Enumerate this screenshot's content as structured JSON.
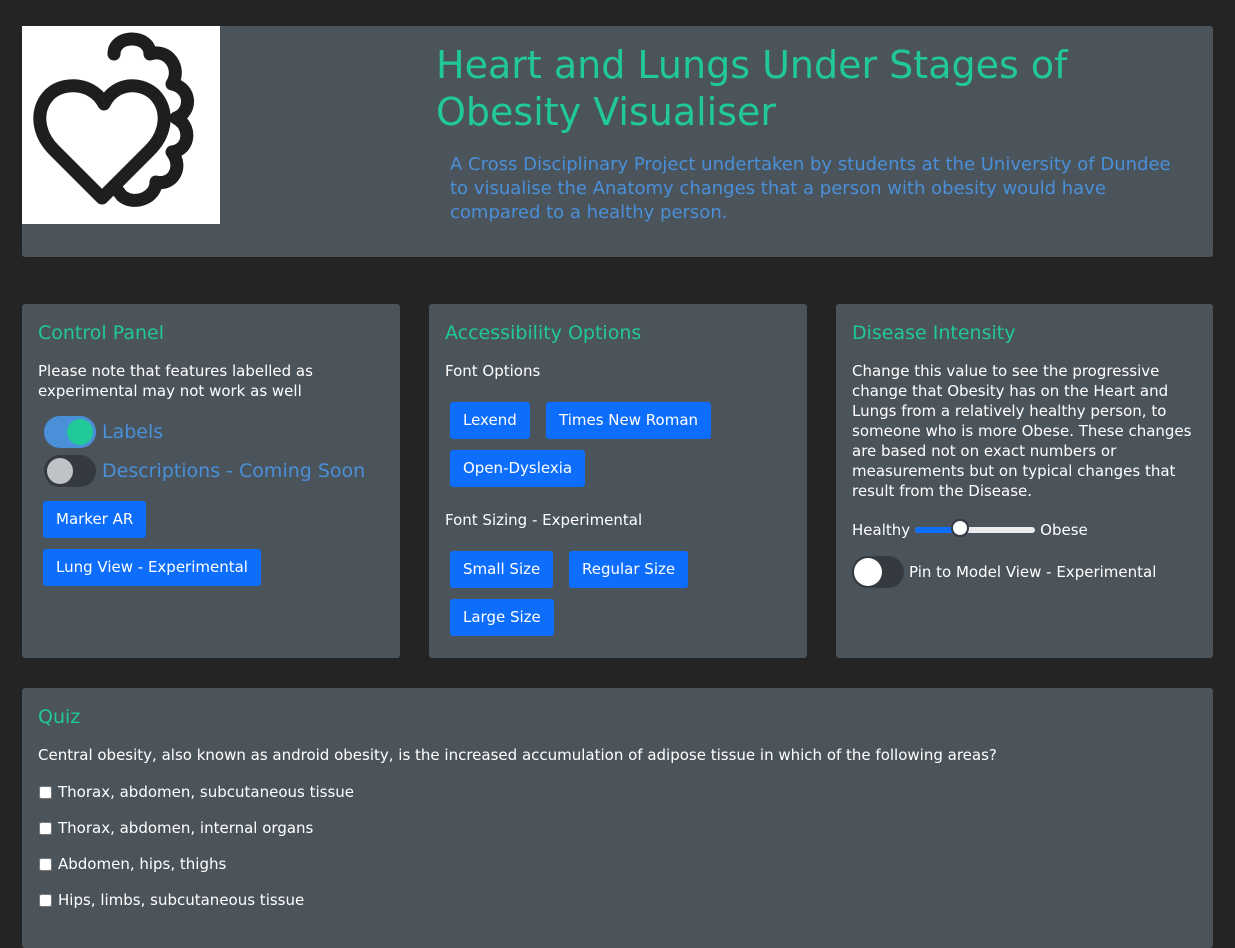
{
  "header": {
    "logo_name": "heart-and-lungs-logo",
    "title": "Heart and Lungs Under Stages of Obesity Visualiser",
    "subtitle": "A Cross Disciplinary Project undertaken by students at the University of Dundee to visualise the Anatomy changes that a person with obesity would have compared to a healthy person."
  },
  "control_panel": {
    "title": "Control Panel",
    "note": "Please note that features labelled as experimental may not work as well",
    "toggles": [
      {
        "label": "Labels",
        "on": true
      },
      {
        "label": "Descriptions - Coming Soon",
        "on": false
      }
    ],
    "buttons": {
      "marker_ar": "Marker AR",
      "lung_view": "Lung View - Experimental"
    }
  },
  "accessibility": {
    "title": "Accessibility Options",
    "font_options_label": "Font Options",
    "font_buttons": [
      "Lexend",
      "Times New Roman",
      "Open-Dyslexia"
    ],
    "font_sizing_label": "Font Sizing - Experimental",
    "size_buttons": [
      "Small Size",
      "Regular Size",
      "Large Size"
    ]
  },
  "disease": {
    "title": "Disease Intensity",
    "description": "Change this value to see the progressive change that Obesity has on the Heart and Lungs from a relatively healthy person, to someone who is more Obese. These changes are based not on exact numbers or measurements but on typical changes that result from the Disease.",
    "slider_min_label": "Healthy",
    "slider_max_label": "Obese",
    "slider_value_fraction": 0.38,
    "pin_label": "Pin to Model View - Experimental",
    "pin_on": false
  },
  "quiz": {
    "title": "Quiz",
    "question": "Central obesity, also known as android obesity, is the increased accumulation of adipose tissue in which of the following areas?",
    "options": [
      "Thorax, abdomen, subcutaneous tissue",
      "Thorax, abdomen, internal organs",
      "Abdomen, hips, thighs",
      "Hips, limbs, subcutaneous tissue"
    ]
  },
  "colors": {
    "page_bg": "#242424",
    "card_bg": "#4b535b",
    "accent_teal": "#20c997",
    "accent_blue": "#4a90d9",
    "button_blue": "#0d6efd"
  }
}
